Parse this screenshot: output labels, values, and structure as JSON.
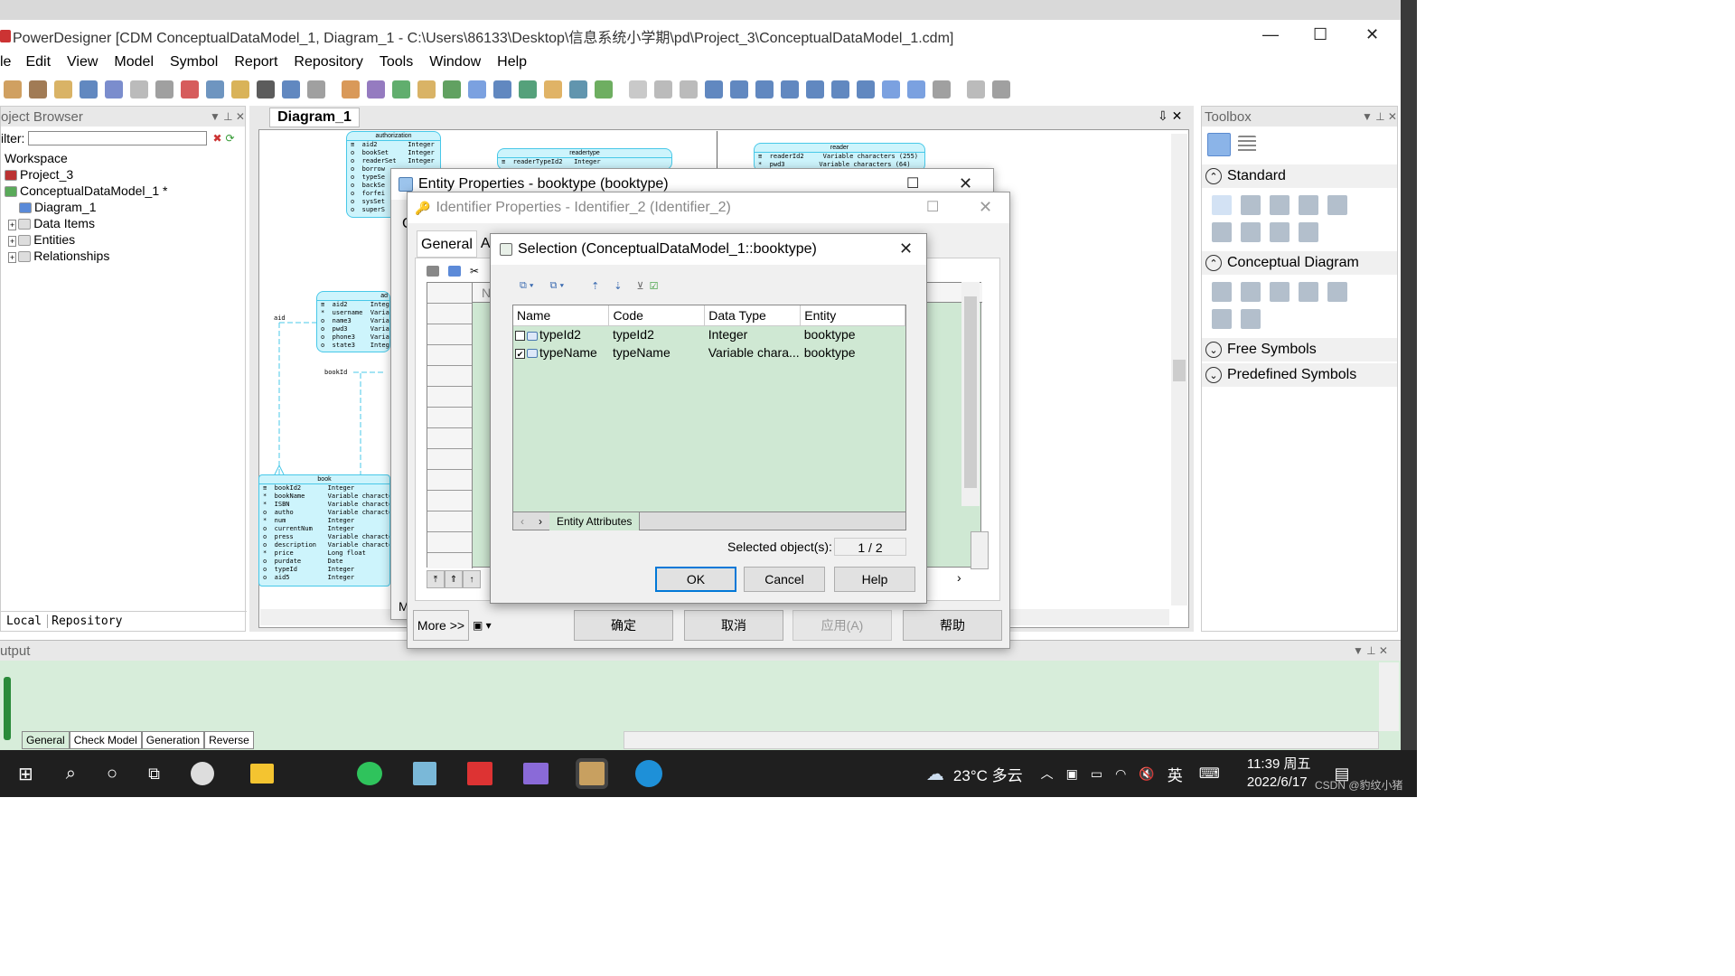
{
  "app": {
    "title": "PowerDesigner [CDM ConceptualDataModel_1, Diagram_1 - C:\\Users\\86133\\Desktop\\信息系统小学期\\pd\\Project_3\\ConceptualDataModel_1.cdm]"
  },
  "menu": [
    "le",
    "Edit",
    "View",
    "Model",
    "Symbol",
    "Report",
    "Repository",
    "Tools",
    "Window",
    "Help"
  ],
  "object_browser": {
    "title": "oject Browser",
    "filter_label": "ilter:",
    "tree": [
      "Workspace",
      "Project_3",
      "ConceptualDataModel_1 *",
      "Diagram_1",
      "Data Items",
      "Entities",
      "Relationships"
    ],
    "tabs": [
      "Local",
      "Repository"
    ]
  },
  "diagram": {
    "tab": "Diagram_1",
    "entities": {
      "authorization": {
        "title": "authorization",
        "rows": [
          "≡  aid2        Integer",
          "o  bookSet     Integer",
          "o  readerSet   Integer",
          "o  borrow",
          "o  typeSe",
          "o  backSe",
          "o  forfei",
          "o  sysSet",
          "o  superS"
        ]
      },
      "readertype": {
        "title": "readertype",
        "rows": [
          "≡  readerTypeId2   Integer"
        ]
      },
      "reader": {
        "title": "reader",
        "rows": [
          "≡  readerId2     Variable characters (255)",
          "*  pwd3         Variable characters (64)"
        ]
      },
      "admin": {
        "title": "ad",
        "rows": [
          "≡  aid2      Integ",
          "*  username  Varia",
          "o  name3     Varia",
          "o  pwd3      Varia",
          "o  phone3    Varia",
          "o  state3    Integ"
        ]
      },
      "book": {
        "title": "book",
        "rows": [
          "≡  bookId2       Integer",
          "*  bookName      Variable characters",
          "*  ISBN          Variable characters",
          "o  autho         Variable characters",
          "*  num           Integer",
          "o  currentNum    Integer",
          "o  press         Variable characters",
          "o  description   Variable characters",
          "*  price         Long float",
          "o  purdate       Date",
          "o  typeId        Integer",
          "o  aid5          Integer"
        ]
      }
    },
    "labels": {
      "aid": "aid",
      "bookId": "bookId"
    }
  },
  "toolbox": {
    "title": "Toolbox",
    "sections": [
      "Standard",
      "Conceptual Diagram",
      "Free Symbols",
      "Predefined Symbols"
    ]
  },
  "output": {
    "title": "utput",
    "tabs": [
      "General",
      "Check Model",
      "Generation",
      "Reverse"
    ]
  },
  "entity_dialog": {
    "title": "Entity Properties - booktype (booktype)",
    "tabs": [
      "General",
      "At"
    ],
    "more": "More >>",
    "buttons": [
      "确定",
      "取消",
      "应用(A)",
      "帮助"
    ],
    "partial_tab": "C",
    "partial_m": "M"
  },
  "identifier_dialog": {
    "title": "Identifier Properties - Identifier_2 (Identifier_2)",
    "partial_col": "Na"
  },
  "selection_dialog": {
    "title": "Selection (ConceptualDataModel_1::booktype)",
    "columns": [
      "Name",
      "Code",
      "Data Type",
      "Entity"
    ],
    "rows": [
      {
        "checked": false,
        "name": "typeId2",
        "code": "typeId2",
        "type": "Integer",
        "entity": "booktype"
      },
      {
        "checked": true,
        "name": "typeName",
        "code": "typeName",
        "type": "Variable chara...",
        "entity": "booktype"
      }
    ],
    "tab": "Entity Attributes",
    "selected_label": "Selected object(s):",
    "selected_value": "1 / 2",
    "ok": "OK",
    "cancel": "Cancel",
    "help": "Help"
  },
  "taskbar": {
    "weather": "23°C  多云",
    "ime": "英",
    "time": "11:39 周五",
    "date": "2022/6/17",
    "watermark": "CSDN @豹纹小猪"
  }
}
